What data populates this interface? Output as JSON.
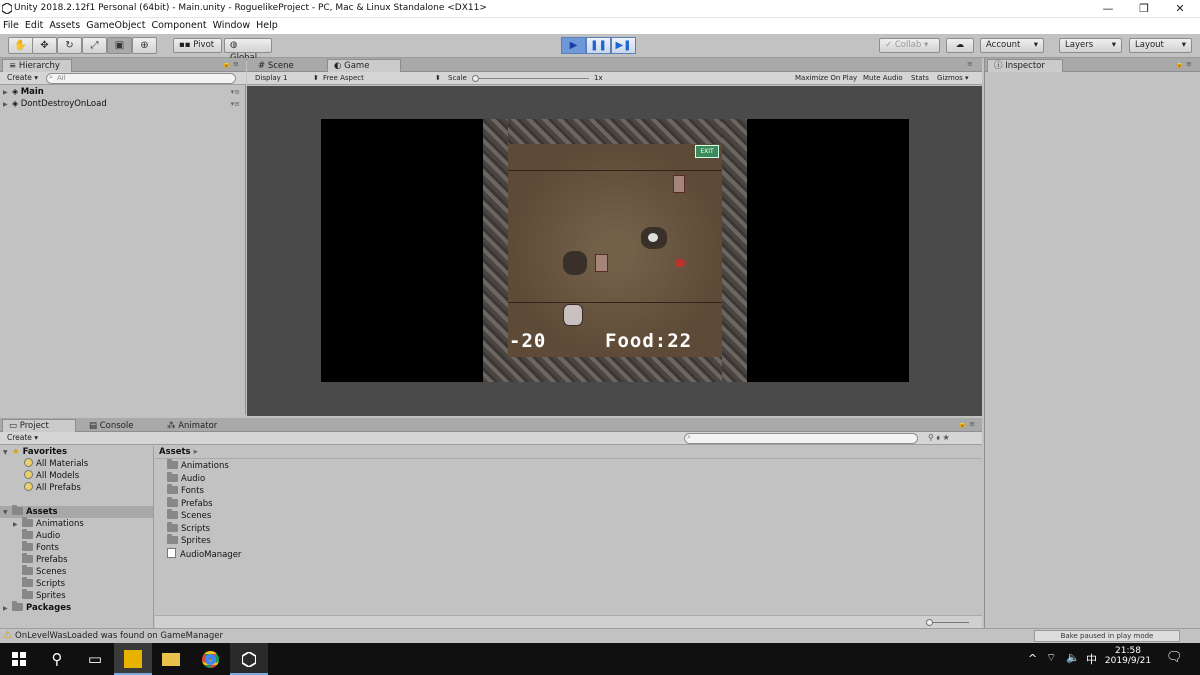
{
  "window": {
    "title": "Unity 2018.2.12f1 Personal (64bit) - Main.unity - RoguelikeProject - PC, Mac & Linux Standalone <DX11>"
  },
  "menu": [
    "File",
    "Edit",
    "Assets",
    "GameObject",
    "Component",
    "Window",
    "Help"
  ],
  "toolbar": {
    "pivot": "Pivot",
    "global": "Global",
    "collab": "Collab",
    "account": "Account",
    "layers": "Layers",
    "layout": "Layout"
  },
  "hierarchy": {
    "tab": "Hierarchy",
    "create": "Create",
    "search_placeholder": "All",
    "items": [
      "Main",
      "DontDestroyOnLoad"
    ]
  },
  "center_tabs": {
    "scene": "Scene",
    "game": "Game"
  },
  "game_bar": {
    "display": "Display 1",
    "aspect": "Free Aspect",
    "scale_label": "Scale",
    "scale_value": "1x",
    "maximize": "Maximize On Play",
    "mute": "Mute Audio",
    "stats": "Stats",
    "gizmos": "Gizmos"
  },
  "game": {
    "hud_left": "-20",
    "hud_right": "Food:22",
    "exit_sign": "EXIT"
  },
  "inspector": {
    "tab": "Inspector"
  },
  "bottom_tabs": {
    "project": "Project",
    "console": "Console",
    "animator": "Animator"
  },
  "project": {
    "create": "Create",
    "favorites_label": "Favorites",
    "favorites": [
      "All Materials",
      "All Models",
      "All Prefabs"
    ],
    "assets_label": "Assets",
    "asset_tree": [
      "Animations",
      "Audio",
      "Fonts",
      "Prefabs",
      "Scenes",
      "Scripts",
      "Sprites"
    ],
    "packages_label": "Packages",
    "breadcrumb": "Assets",
    "files": [
      "Animations",
      "Audio",
      "Fonts",
      "Prefabs",
      "Scenes",
      "Scripts",
      "Sprites",
      "AudioManager"
    ]
  },
  "status": {
    "message": "OnLevelWasLoaded was found on GameManager",
    "bake": "Bake paused in play mode"
  },
  "taskbar": {
    "time": "21:58",
    "date": "2019/9/21",
    "ime": "中"
  }
}
